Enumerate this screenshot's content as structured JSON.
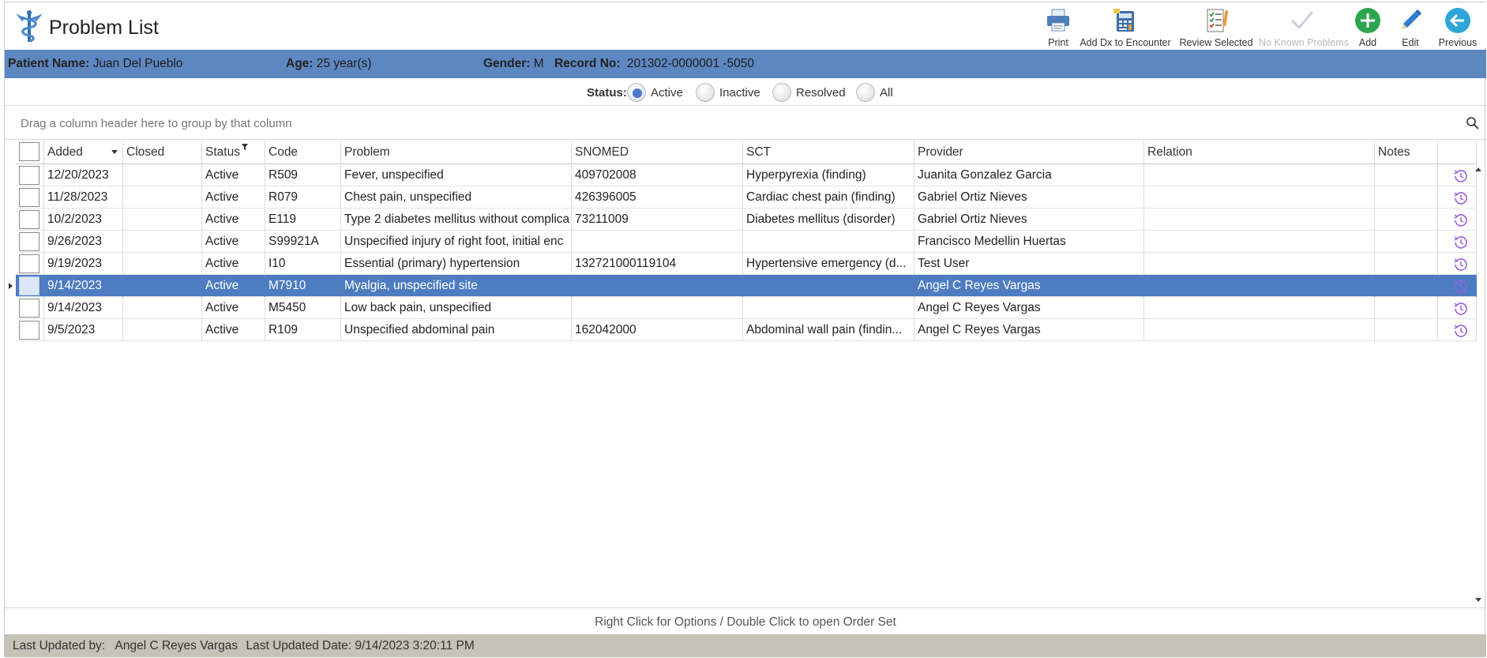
{
  "app": {
    "title": "Problem List"
  },
  "toolbar": [
    {
      "key": "print",
      "label": "Print",
      "icon": "printer-icon",
      "enabled": true
    },
    {
      "key": "add_dx",
      "label": "Add Dx to Encounter",
      "icon": "calculator-icon",
      "enabled": true
    },
    {
      "key": "review",
      "label": "Review Selected",
      "icon": "checklist-icon",
      "enabled": true
    },
    {
      "key": "nkp",
      "label": "No Known Problems",
      "icon": "checkmark-icon",
      "enabled": false
    },
    {
      "key": "add",
      "label": "Add",
      "icon": "plus-icon",
      "enabled": true
    },
    {
      "key": "edit",
      "label": "Edit",
      "icon": "pencil-icon",
      "enabled": true
    },
    {
      "key": "previous",
      "label": "Previous",
      "icon": "back-arrow-icon",
      "enabled": true
    }
  ],
  "patient": {
    "name_label": "Patient Name:",
    "name": "Juan Del Pueblo",
    "age_label": "Age:",
    "age": "25 year(s)",
    "gender_label": "Gender:",
    "gender": "M",
    "record_label": "Record No:",
    "record": "201302-0000001 -5050"
  },
  "status_filter": {
    "label": "Status:",
    "options": [
      "Active",
      "Inactive",
      "Resolved",
      "All"
    ],
    "selected": "Active"
  },
  "group_panel": {
    "text": "Drag a column header here to group by that column"
  },
  "grid": {
    "columns": [
      "Added",
      "Closed",
      "Status",
      "Code",
      "Problem",
      "SNOMED",
      "SCT",
      "Provider",
      "Relation",
      "Notes"
    ],
    "rows": [
      {
        "added": "12/20/2023",
        "closed": "",
        "status": "Active",
        "code": "R509",
        "problem": "Fever, unspecified",
        "snomed": "409702008",
        "sct": "Hyperpyrexia (finding)",
        "provider": "Juanita Gonzalez Garcia",
        "relation": "",
        "notes": ""
      },
      {
        "added": "11/28/2023",
        "closed": "",
        "status": "Active",
        "code": "R079",
        "problem": "Chest pain, unspecified",
        "snomed": "426396005",
        "sct": "Cardiac chest pain (finding)",
        "provider": "Gabriel Ortiz Nieves",
        "relation": "",
        "notes": ""
      },
      {
        "added": "10/2/2023",
        "closed": "",
        "status": "Active",
        "code": "E119",
        "problem": "Type 2 diabetes mellitus without complica",
        "snomed": "73211009",
        "sct": "Diabetes mellitus (disorder)",
        "provider": "Gabriel Ortiz Nieves",
        "relation": "",
        "notes": ""
      },
      {
        "added": "9/26/2023",
        "closed": "",
        "status": "Active",
        "code": "S99921A",
        "problem": "Unspecified injury of right foot, initial enc",
        "snomed": "",
        "sct": "",
        "provider": "Francisco Medellin Huertas",
        "relation": "",
        "notes": ""
      },
      {
        "added": "9/19/2023",
        "closed": "",
        "status": "Active",
        "code": "I10",
        "problem": "Essential (primary) hypertension",
        "snomed": "132721000119104",
        "sct": "Hypertensive emergency (d...",
        "provider": "Test User",
        "relation": "",
        "notes": ""
      },
      {
        "added": "9/14/2023",
        "closed": "",
        "status": "Active",
        "code": "M7910",
        "problem": "Myalgia, unspecified site",
        "snomed": "",
        "sct": "",
        "provider": "Angel C Reyes Vargas",
        "relation": "",
        "notes": "",
        "selected": true
      },
      {
        "added": "9/14/2023",
        "closed": "",
        "status": "Active",
        "code": "M5450",
        "problem": "Low back pain, unspecified",
        "snomed": "",
        "sct": "",
        "provider": "Angel C Reyes Vargas",
        "relation": "",
        "notes": ""
      },
      {
        "added": "9/5/2023",
        "closed": "",
        "status": "Active",
        "code": "R109",
        "problem": "Unspecified abdominal pain",
        "snomed": "162042000",
        "sct": "Abdominal wall pain (findin...",
        "provider": "Angel C Reyes Vargas",
        "relation": "",
        "notes": ""
      }
    ]
  },
  "hint": "Right Click for Options / Double Click to open Order Set",
  "footer": {
    "updated_by_label": "Last Updated by:",
    "updated_by": "Angel C Reyes Vargas",
    "updated_date_label": "Last Updated Date:",
    "updated_date": "9/14/2023 3:20:11 PM"
  },
  "colors": {
    "accent": "#5d87c1",
    "selected_row": "#4d7cc0",
    "footer": "#c5c2b8",
    "history_icon": "#9b5de5"
  }
}
